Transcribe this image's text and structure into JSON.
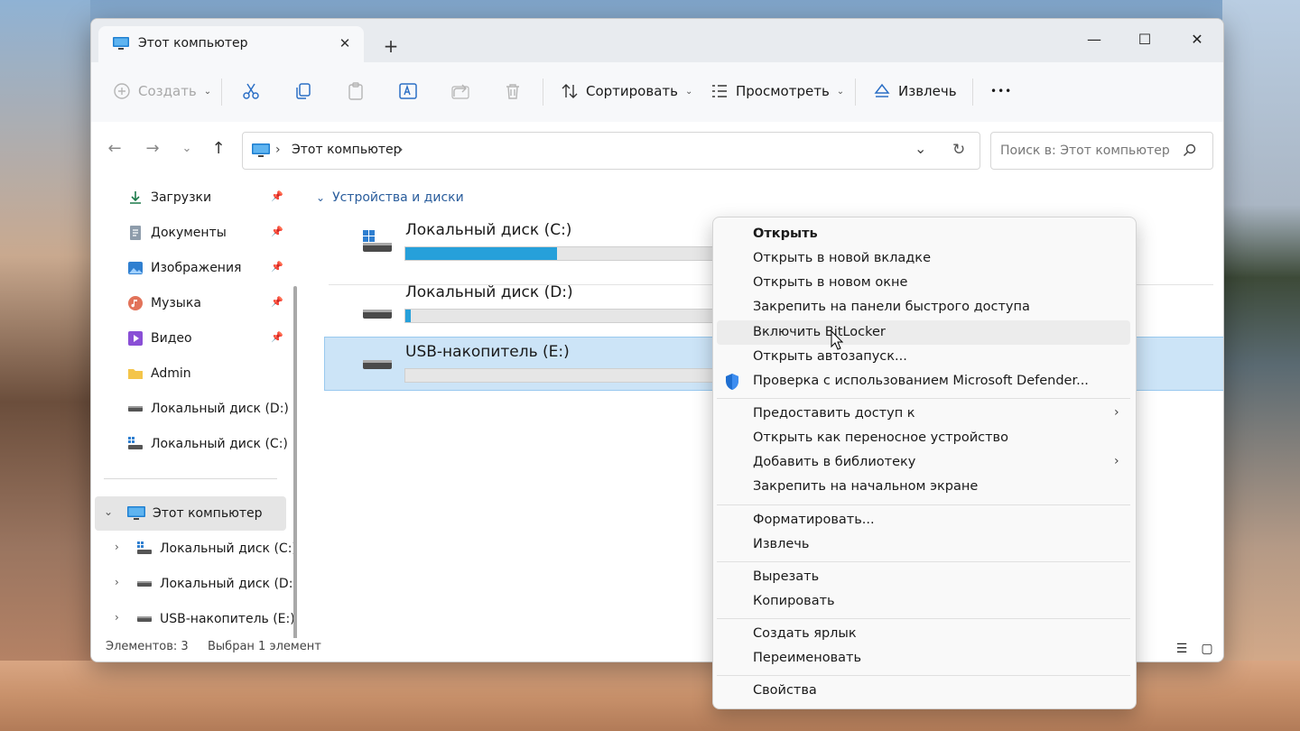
{
  "window": {
    "tab_title": "Этот компьютер",
    "tab_close": "✕",
    "new_tab": "+",
    "minimize": "—",
    "maximize": "☐",
    "close": "✕"
  },
  "toolbar": {
    "create_label": "Создать",
    "sort_label": "Сортировать",
    "view_label": "Просмотреть",
    "eject_label": "Извлечь",
    "more_label": "•••"
  },
  "address": {
    "path": "Этот компьютер",
    "search_placeholder": "Поиск в: Этот компьютер"
  },
  "sidebar": {
    "quick": [
      {
        "label": "Загрузки",
        "icon": "download-icon",
        "pinned": true
      },
      {
        "label": "Документы",
        "icon": "documents-icon",
        "pinned": true
      },
      {
        "label": "Изображения",
        "icon": "pictures-icon",
        "pinned": true
      },
      {
        "label": "Музыка",
        "icon": "music-icon",
        "pinned": true
      },
      {
        "label": "Видео",
        "icon": "video-icon",
        "pinned": true
      },
      {
        "label": "Admin",
        "icon": "folder-icon",
        "pinned": false
      },
      {
        "label": "Локальный диск (D:)",
        "icon": "drive-icon",
        "pinned": false
      },
      {
        "label": "Локальный диск (C:)",
        "icon": "system-drive-icon",
        "pinned": false
      }
    ],
    "this_pc": "Этот компьютер",
    "tree": [
      {
        "label": "Локальный диск (C:)"
      },
      {
        "label": "Локальный диск (D:)"
      },
      {
        "label": "USB-накопитель (E:)"
      }
    ]
  },
  "content": {
    "group_title": "Устройства и диски",
    "drives": [
      {
        "label": "Локальный диск (C:)",
        "used_fraction": 0.4,
        "selected": false
      },
      {
        "label": "Локальный диск (D:)",
        "used_fraction": 0.015,
        "selected": false
      },
      {
        "label": "USB-накопитель (E:)",
        "used_fraction": 0.0,
        "selected": true
      }
    ]
  },
  "status": {
    "count": "Элементов: 3",
    "selection": "Выбран 1 элемент"
  },
  "context_menu": {
    "items": [
      {
        "label": "Открыть",
        "bold": true
      },
      {
        "label": "Открыть в новой вкладке"
      },
      {
        "label": "Открыть в новом окне"
      },
      {
        "label": "Закрепить на панели быстрого доступа"
      },
      {
        "label": "Включить BitLocker",
        "hovered": true
      },
      {
        "label": "Открыть автозапуск..."
      },
      {
        "label": "Проверка с использованием Microsoft Defender..."
      },
      {
        "label": "Предоставить доступ к",
        "submenu": true
      },
      {
        "label": "Открыть как переносное устройство"
      },
      {
        "label": "Добавить в библиотеку",
        "submenu": true
      },
      {
        "label": "Закрепить на начальном экране"
      },
      {
        "label": "Форматировать..."
      },
      {
        "label": "Извлечь"
      },
      {
        "label": "Вырезать"
      },
      {
        "label": "Копировать"
      },
      {
        "label": "Создать ярлык"
      },
      {
        "label": "Переименовать"
      },
      {
        "label": "Свойства"
      }
    ]
  },
  "colors": {
    "accent": "#26a0da",
    "selection": "#cce4f7",
    "link": "#2a5d9c"
  }
}
